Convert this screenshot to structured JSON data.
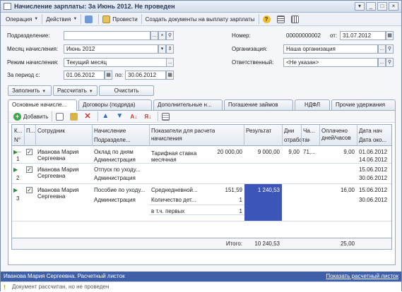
{
  "window": {
    "title": "Начисление зарплаты: За Июнь 2012. Не проведен"
  },
  "toolbar": {
    "operation": "Операция",
    "actions": "Действия",
    "post": "Провести",
    "create_payment_docs": "Создать документы на выплату зарплаты"
  },
  "form": {
    "subdivision_label": "Подразделение:",
    "subdivision_value": "",
    "month_label": "Месяц начисления:",
    "month_value": "Июнь 2012",
    "mode_label": "Режим начисления:",
    "mode_value": "Текущий месяц",
    "period_label": "За период с:",
    "period_from": "01.06.2012",
    "period_to_label": "по:",
    "period_to": "30.06.2012",
    "number_label": "Номер:",
    "number_value": "00000000002",
    "date_label": "от:",
    "date_value": "31.07.2012",
    "org_label": "Организация:",
    "org_value": "Наша организация",
    "responsible_label": "Ответственный:",
    "responsible_value": "<Не указан>"
  },
  "buttons": {
    "fill": "Заполнить",
    "calculate": "Рассчитать",
    "clear": "Очистить"
  },
  "tabs": [
    "Основные начисле...",
    "Договоры (подряда)",
    "Дополнительные н...",
    "Погашение займов",
    "НДФЛ",
    "Прочие удержания"
  ],
  "panel_toolbar": {
    "add": "Добавить"
  },
  "grid": {
    "headers": {
      "k": "К...",
      "p": "П...",
      "n": "N°",
      "employee": "Сотрудник",
      "accrual": "Начисление",
      "division": "Подразделе...",
      "indicators": "Показатели для расчета",
      "indicators2": "начисления",
      "result": "Результат",
      "days": "Дни",
      "days_worked": "отработано",
      "hours": "Ча...",
      "paid": "Оплачено",
      "paid2": "дней/часов",
      "date_start": "Дата нач",
      "date_end": "Дата око..."
    },
    "rows": [
      {
        "n": "1",
        "employee": "Иванова Мария Сергеевна",
        "accrual": "Оклад по дням",
        "division": "Администрация",
        "ind_name": "Тарифная ставка месячная",
        "ind_value": "20 000,00",
        "result": "9 000,00",
        "days": "9,00",
        "hours": "71,...",
        "paid": "9,00",
        "date_start": "01.06.2012",
        "date_end": "14.06.2012"
      },
      {
        "n": "2",
        "employee": "Иванова Мария Сергеевна",
        "accrual": "Отпуск по уходу...",
        "division": "Администрация",
        "date_start": "15.06.2012",
        "date_end": "30.06.2012"
      },
      {
        "n": "3",
        "employee": "Иванова Мария Сергеевна",
        "accrual": "Пособие по уходу...",
        "division": "Администрация",
        "ind1_name": "Среднедневной...",
        "ind1_value": "151,59",
        "ind2_name": "Количество дет...",
        "ind2_value": "1",
        "ind3_name": "в т.ч. первых",
        "ind3_value": "1",
        "result": "1 240,53",
        "paid": "16,00",
        "date_start": "15.06.2012",
        "date_end": "30.06.2012"
      }
    ],
    "totals": {
      "label": "Итого:",
      "result": "10 240,53",
      "paid": "25,00"
    }
  },
  "status": {
    "text": "Иванова Мария Сергеевна. Расчетный листок",
    "link": "Показать расчетный листок",
    "message": "Документ рассчитан, но не проведен"
  },
  "colors": {
    "selected_cell": "#3e55b8",
    "status_bar": "#3f60a8"
  }
}
